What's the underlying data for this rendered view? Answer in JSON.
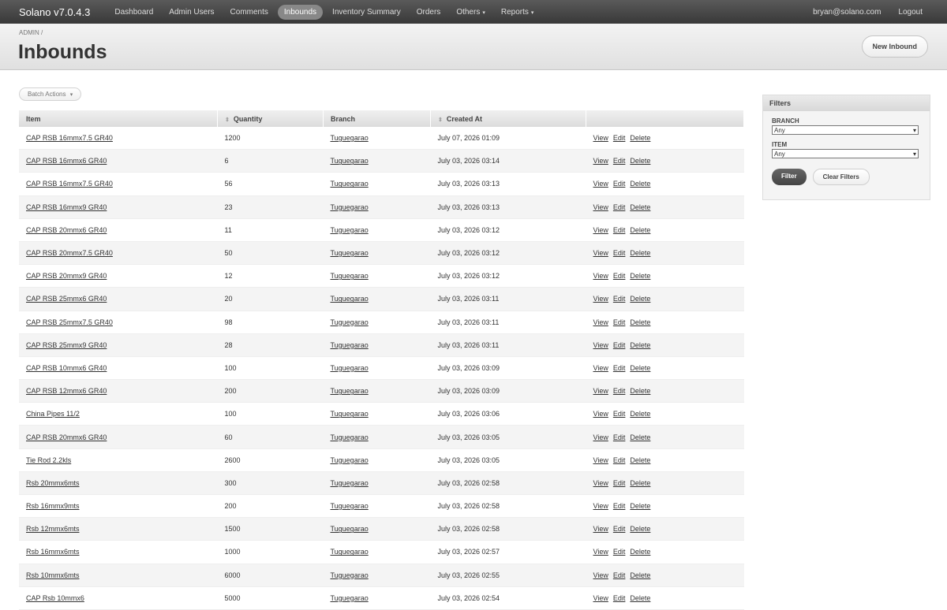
{
  "app": {
    "brand": "Solano v7.0.4.3"
  },
  "nav": [
    {
      "label": "Dashboard"
    },
    {
      "label": "Admin Users"
    },
    {
      "label": "Comments"
    },
    {
      "label": "Inbounds",
      "active": true
    },
    {
      "label": "Inventory Summary"
    },
    {
      "label": "Orders"
    },
    {
      "label": "Others",
      "dropdown": true
    },
    {
      "label": "Reports",
      "dropdown": true
    }
  ],
  "user": {
    "email": "bryan@solano.com",
    "logout": "Logout"
  },
  "page": {
    "breadcrumb": "ADMIN /",
    "title": "Inbounds",
    "new_button": "New Inbound",
    "batch_actions": "Batch Actions"
  },
  "table": {
    "headers": [
      "Item",
      "Quantity",
      "Branch",
      "Created At",
      ""
    ],
    "actions": [
      "View",
      "Edit",
      "Delete"
    ],
    "rows": [
      {
        "item": "CAP RSB 16mmx7.5 GR40",
        "qty": "1200",
        "branch": "Tuguegarao",
        "created": "July 07, 2026 01:09"
      },
      {
        "item": "CAP RSB 16mmx6 GR40",
        "qty": "6",
        "branch": "Tuguegarao",
        "created": "July 03, 2026 03:14"
      },
      {
        "item": "CAP RSB 16mmx7.5 GR40",
        "qty": "56",
        "branch": "Tuguegarao",
        "created": "July 03, 2026 03:13"
      },
      {
        "item": "CAP RSB 16mmx9 GR40",
        "qty": "23",
        "branch": "Tuguegarao",
        "created": "July 03, 2026 03:13"
      },
      {
        "item": "CAP RSB 20mmx6 GR40",
        "qty": "11",
        "branch": "Tuguegarao",
        "created": "July 03, 2026 03:12"
      },
      {
        "item": "CAP RSB 20mmx7.5 GR40",
        "qty": "50",
        "branch": "Tuguegarao",
        "created": "July 03, 2026 03:12"
      },
      {
        "item": "CAP RSB 20mmx9 GR40",
        "qty": "12",
        "branch": "Tuguegarao",
        "created": "July 03, 2026 03:12"
      },
      {
        "item": "CAP RSB 25mmx6 GR40",
        "qty": "20",
        "branch": "Tuguegarao",
        "created": "July 03, 2026 03:11"
      },
      {
        "item": "CAP RSB 25mmx7.5 GR40",
        "qty": "98",
        "branch": "Tuguegarao",
        "created": "July 03, 2026 03:11"
      },
      {
        "item": "CAP RSB 25mmx9 GR40",
        "qty": "28",
        "branch": "Tuguegarao",
        "created": "July 03, 2026 03:11"
      },
      {
        "item": "CAP RSB 10mmx6 GR40",
        "qty": "100",
        "branch": "Tuguegarao",
        "created": "July 03, 2026 03:09"
      },
      {
        "item": "CAP RSB 12mmx6 GR40",
        "qty": "200",
        "branch": "Tuguegarao",
        "created": "July 03, 2026 03:09"
      },
      {
        "item": "China Pipes 11/2",
        "qty": "100",
        "branch": "Tuguegarao",
        "created": "July 03, 2026 03:06"
      },
      {
        "item": "CAP RSB 20mmx6 GR40",
        "qty": "60",
        "branch": "Tuguegarao",
        "created": "July 03, 2026 03:05"
      },
      {
        "item": "Tie Rod 2.2kls",
        "qty": "2600",
        "branch": "Tuguegarao",
        "created": "July 03, 2026 03:05"
      },
      {
        "item": "Rsb 20mmx6mts",
        "qty": "300",
        "branch": "Tuguegarao",
        "created": "July 03, 2026 02:58"
      },
      {
        "item": "Rsb 16mmx9mts",
        "qty": "200",
        "branch": "Tuguegarao",
        "created": "July 03, 2026 02:58"
      },
      {
        "item": "Rsb 12mmx6mts",
        "qty": "1500",
        "branch": "Tuguegarao",
        "created": "July 03, 2026 02:58"
      },
      {
        "item": "Rsb 16mmx6mts",
        "qty": "1000",
        "branch": "Tuguegarao",
        "created": "July 03, 2026 02:57"
      },
      {
        "item": "Rsb 10mmx6mts",
        "qty": "6000",
        "branch": "Tuguegarao",
        "created": "July 03, 2026 02:55"
      },
      {
        "item": "CAP Rsb 10mmx6",
        "qty": "5000",
        "branch": "Tuguegarao",
        "created": "July 03, 2026 02:54"
      }
    ]
  },
  "filters": {
    "title": "Filters",
    "branch_label": "BRANCH",
    "branch_value": "Any",
    "item_label": "ITEM",
    "item_value": "Any",
    "filter_button": "Filter",
    "clear_button": "Clear Filters"
  }
}
